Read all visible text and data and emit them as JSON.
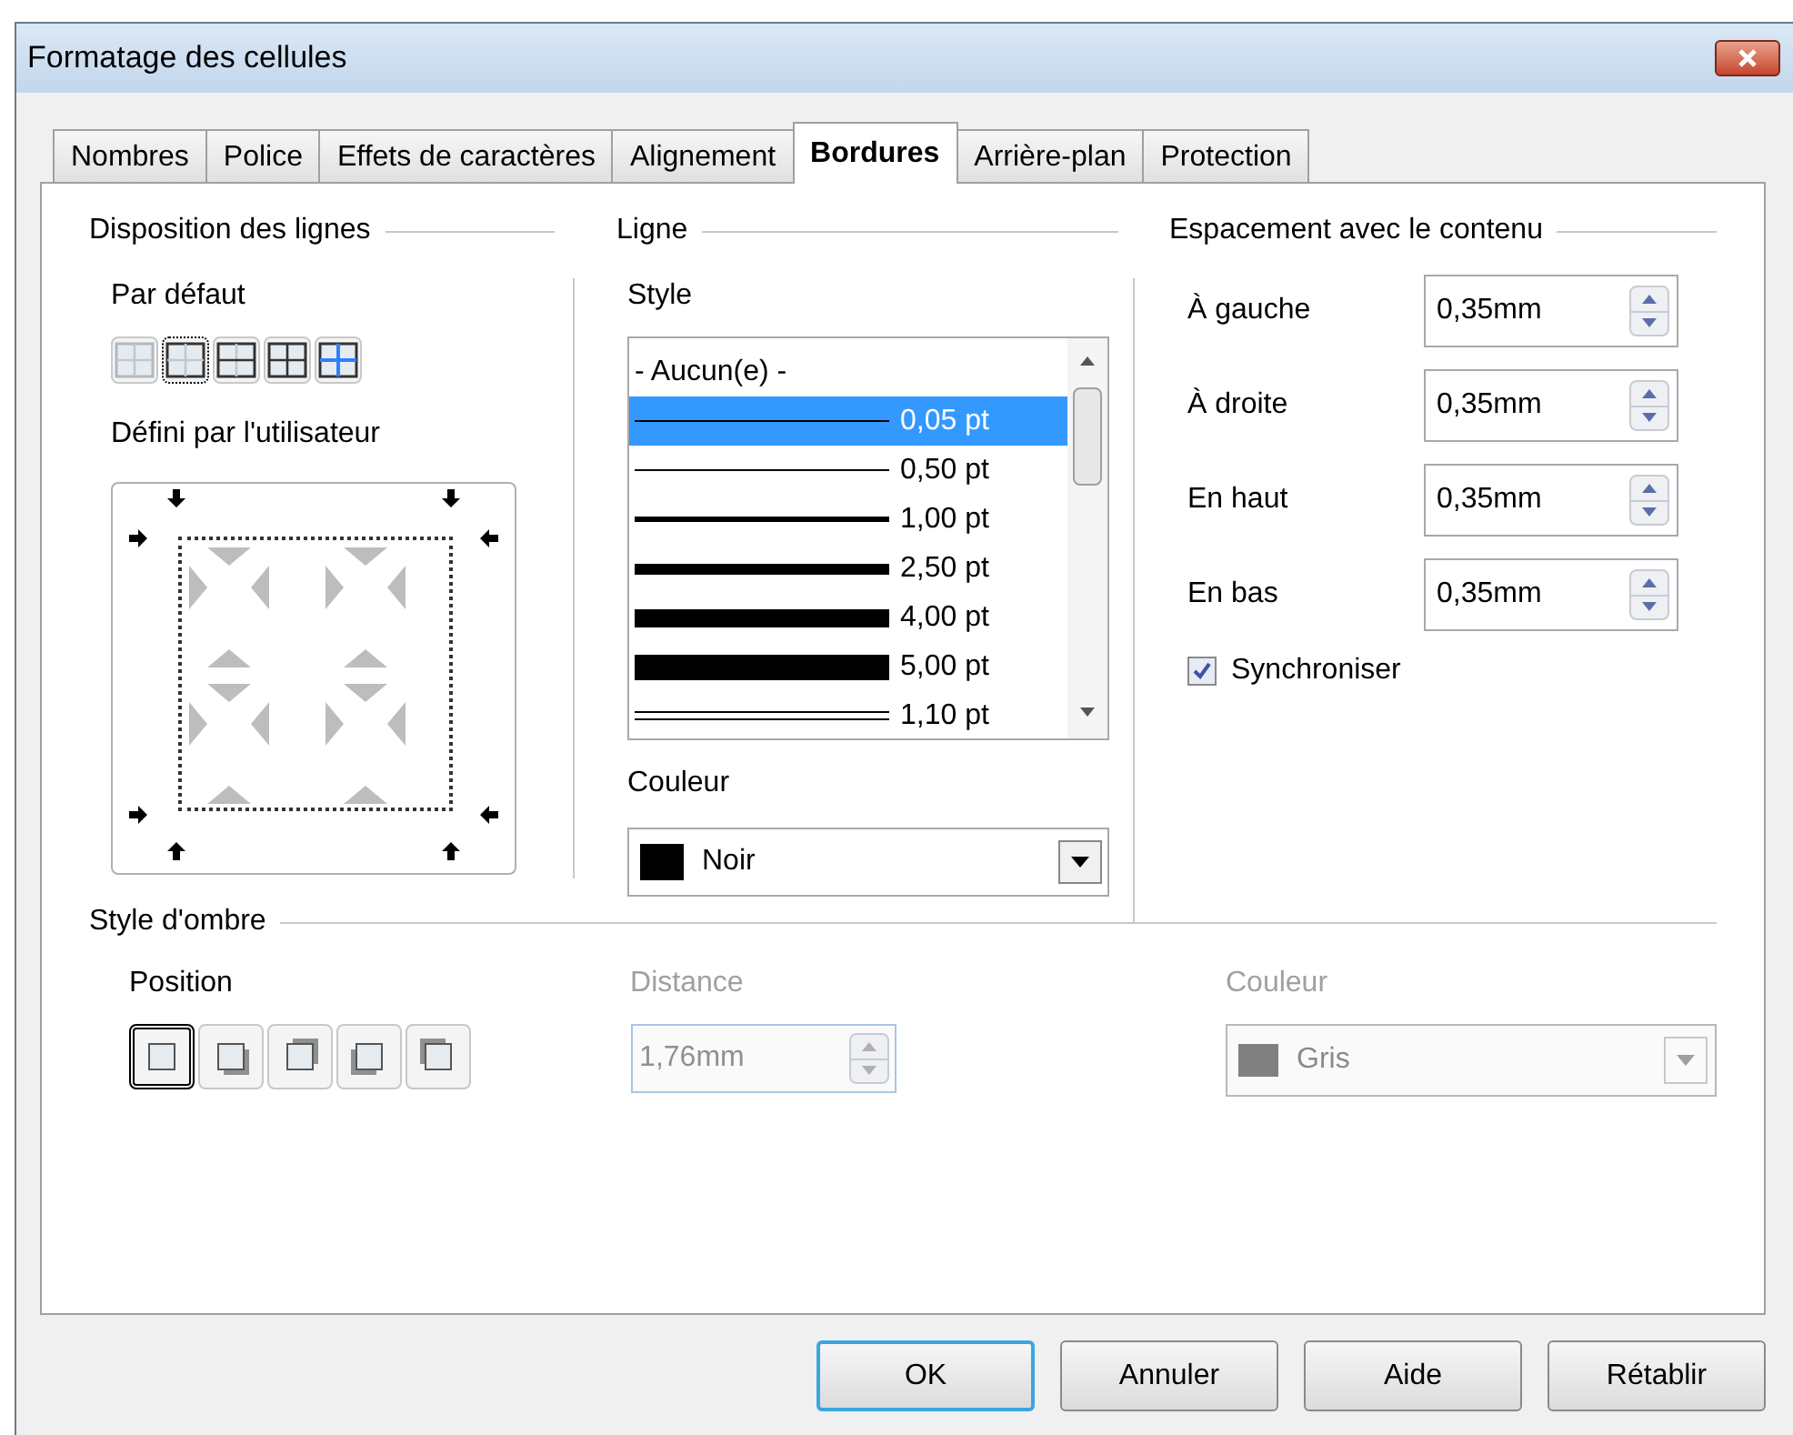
{
  "window": {
    "title": "Formatage des cellules"
  },
  "tabs": [
    {
      "label": "Nombres",
      "selected": false
    },
    {
      "label": "Police",
      "selected": false
    },
    {
      "label": "Effets de caractères",
      "selected": false
    },
    {
      "label": "Alignement",
      "selected": false
    },
    {
      "label": "Bordures",
      "selected": true
    },
    {
      "label": "Arrière-plan",
      "selected": false
    },
    {
      "label": "Protection",
      "selected": false
    }
  ],
  "line_arrangement": {
    "title": "Disposition des lignes",
    "default_label": "Par défaut",
    "presets": [
      {
        "kind": "none",
        "selected": false
      },
      {
        "kind": "outer",
        "selected": true
      },
      {
        "kind": "outer-horizontal",
        "selected": false
      },
      {
        "kind": "all",
        "selected": false
      },
      {
        "kind": "outer-inner",
        "selected": false
      }
    ],
    "user_label": "Défini par l'utilisateur"
  },
  "line": {
    "title": "Ligne",
    "style_label": "Style",
    "styles": [
      {
        "kind": "none",
        "label": "- Aucun(e) -",
        "selected": false
      },
      {
        "kind": "hairline",
        "label": "0,05 pt",
        "selected": true
      },
      {
        "kind": "thin",
        "label": "0,50 pt",
        "selected": false
      },
      {
        "kind": "medium",
        "label": "1,00 pt",
        "selected": false
      },
      {
        "kind": "thick",
        "label": "2,50 pt",
        "selected": false
      },
      {
        "kind": "heavy",
        "label": "4,00 pt",
        "selected": false
      },
      {
        "kind": "extra",
        "label": "5,00 pt",
        "selected": false
      },
      {
        "kind": "double",
        "label": "1,10 pt",
        "selected": false
      }
    ],
    "color_label": "Couleur",
    "color": {
      "name": "Noir",
      "color": "#000000"
    }
  },
  "spacing": {
    "title": "Espacement avec le contenu",
    "fields": [
      {
        "label": "À gauche",
        "value": "0,35mm"
      },
      {
        "label": "À droite",
        "value": "0,35mm"
      },
      {
        "label": "En haut",
        "value": "0,35mm"
      },
      {
        "label": "En bas",
        "value": "0,35mm"
      }
    ],
    "sync": {
      "label": "Synchroniser",
      "checked": true
    }
  },
  "shadow": {
    "title": "Style d'ombre",
    "position_label": "Position",
    "positions": [
      {
        "kind": "none",
        "selected": true
      },
      {
        "kind": "bottom-right",
        "selected": false
      },
      {
        "kind": "top-right",
        "selected": false
      },
      {
        "kind": "bottom-left",
        "selected": false
      },
      {
        "kind": "top-left",
        "selected": false
      }
    ],
    "distance_label": "Distance",
    "distance": {
      "value": "1,76mm",
      "disabled": true
    },
    "color_label": "Couleur",
    "color": {
      "name": "Gris",
      "color": "#808080",
      "disabled": true
    }
  },
  "buttons": [
    {
      "label": "OK",
      "default": true
    },
    {
      "label": "Annuler",
      "default": false
    },
    {
      "label": "Aide",
      "default": false
    },
    {
      "label": "Rétablir",
      "default": false
    }
  ]
}
